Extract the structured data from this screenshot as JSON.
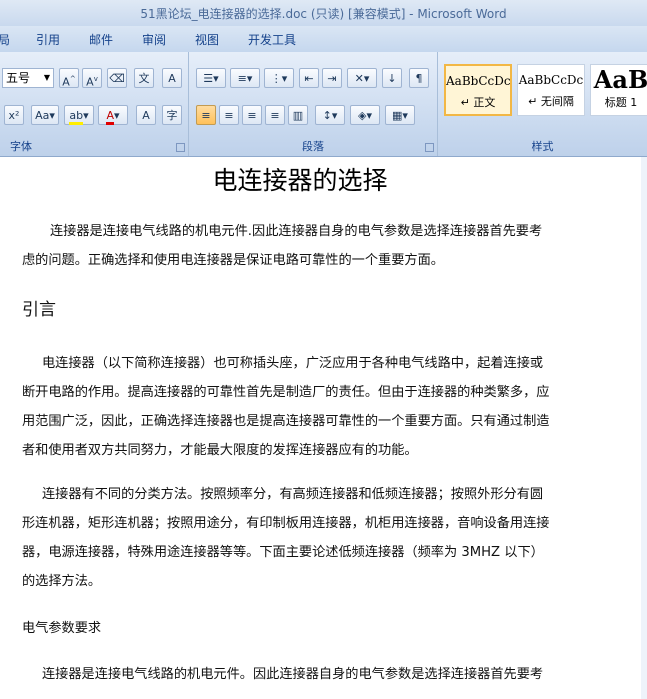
{
  "window": {
    "title": "51黑论坛_电连接器的选择.doc (只读) [兼容模式] - Microsoft Word"
  },
  "menu": [
    "局",
    "引用",
    "邮件",
    "审阅",
    "视图",
    "开发工具"
  ],
  "ribbon": {
    "font_size": "五号",
    "font_label": "字体",
    "paragraph_label": "段落",
    "styles_label": "样式",
    "styles": [
      {
        "preview": "AaBbCcDc",
        "name": "↵ 正文"
      },
      {
        "preview": "AaBbCcDc",
        "name": "↵ 无间隔"
      },
      {
        "preview": "AaB",
        "name": "标题 1"
      }
    ]
  },
  "document": {
    "title": "电连接器的选择",
    "intro_lines": [
      "连接器是连接电气线路的机电元件.因此连接器自身的电气参数是选择连接器首先要考",
      "虑的问题。正确选择和使用电连接器是保证电路可靠性的一个重要方面。"
    ],
    "heading1": "引言",
    "para1_lines": [
      "电连接器（以下简称连接器）也可称插头座，广泛应用于各种电气线路中，起着连接或",
      "断开电路的作用。提高连接器的可靠性首先是制造厂的责任。但由于连接器的种类繁多，应",
      "用范围广泛，因此，正确选择连接器也是提高连接器可靠性的一个重要方面。只有通过制造",
      "者和使用者双方共同努力，才能最大限度的发挥连接器应有的功能。"
    ],
    "para2_lines": [
      "连接器有不同的分类方法。按照频率分，有高频连接器和低频连接器；按照外形分有圆",
      "形连机器，矩形连机器；按照用途分，有印制板用连接器，机柜用连接器，音响设备用连接",
      "器，电源连接器，特殊用途连接器等等。下面主要论述低频连接器（频率为 3MHZ 以下）",
      "的选择方法。"
    ],
    "heading2": "电气参数要求",
    "para3_first": "连接器是连接电气线路的机电元件。因此连接器自身的电气参数是选择连接器首先要考"
  }
}
